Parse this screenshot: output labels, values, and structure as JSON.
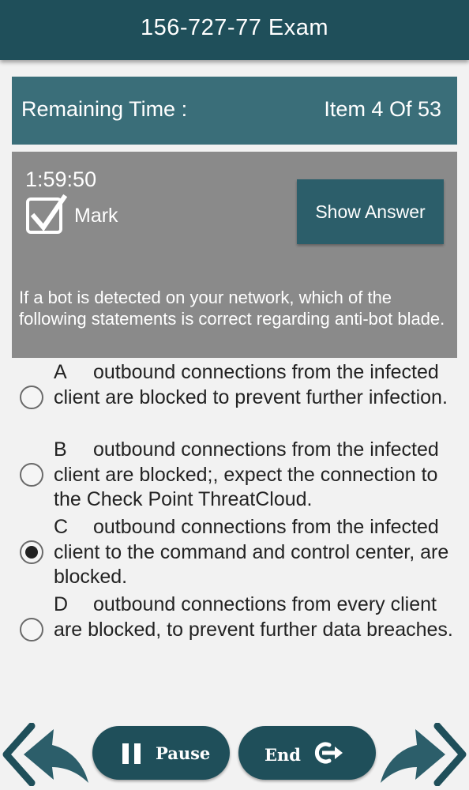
{
  "header": {
    "title": "156-727-77 Exam"
  },
  "info": {
    "remaining_label": "Remaining Time :",
    "item_counter": "Item 4 Of 53"
  },
  "panel": {
    "timer": "1:59:50",
    "mark_label": "Mark",
    "mark_checked": true,
    "show_answer_label": "Show Answer"
  },
  "question": "If a bot is detected on your network, which of the following statements is correct regarding anti-bot blade.",
  "options": [
    {
      "letter": "A",
      "text": "outbound connections from the infected client are blocked to prevent further infection.",
      "selected": false
    },
    {
      "letter": "B",
      "text": "outbound connections from the infected client are blocked;, expect the connection to the Check Point ThreatCloud.",
      "selected": false
    },
    {
      "letter": "C",
      "text": "outbound connections from the infected client to the command and control center, are blocked.",
      "selected": true
    },
    {
      "letter": "D",
      "text": "outbound connections from every client are blocked, to prevent further data breaches.",
      "selected": false
    }
  ],
  "footer": {
    "pause_label": "Pause",
    "end_label": "End"
  },
  "colors": {
    "header": "#1f4f5a",
    "info_bar": "#3a6e79",
    "panel": "#8a8a8a",
    "button": "#2c5e6a"
  }
}
